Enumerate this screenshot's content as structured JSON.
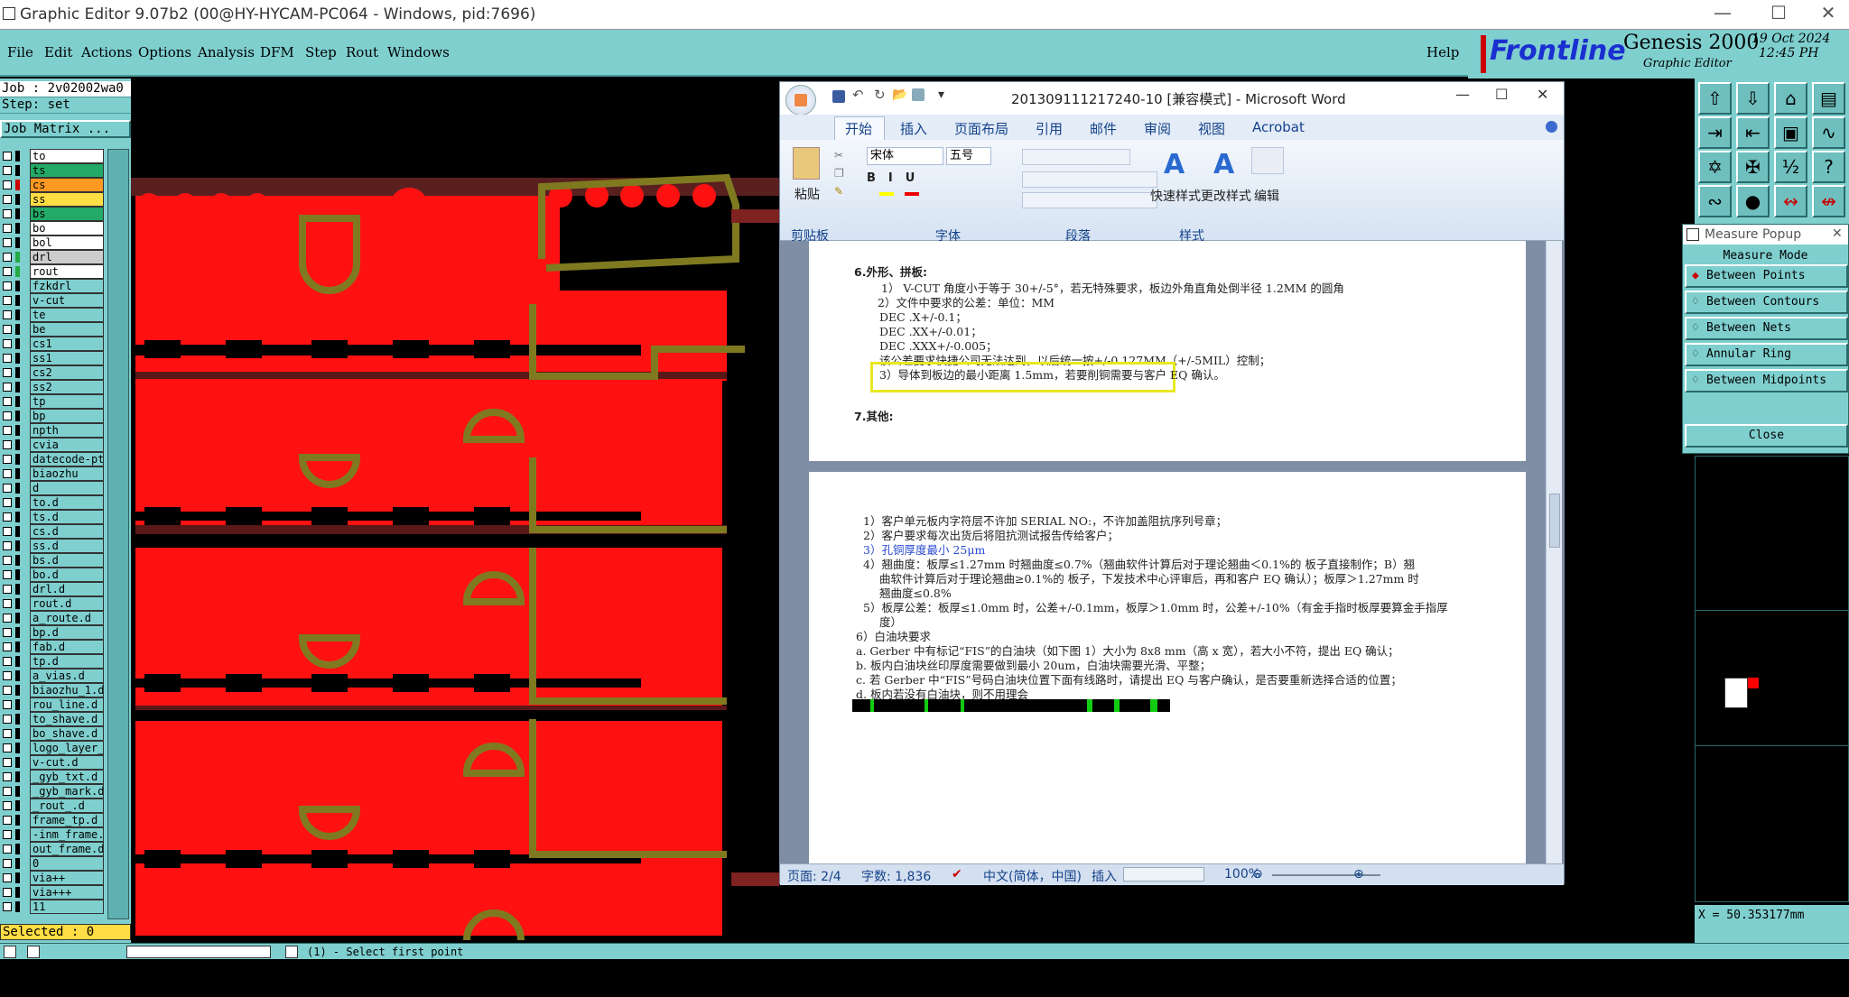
{
  "window": {
    "title": "Graphic Editor 9.07b2 (00@HY-HYCAM-PC064 - Windows, pid:7696)"
  },
  "menu": {
    "items": [
      "File",
      "Edit",
      "Actions",
      "Options",
      "Analysis",
      "DFM",
      "Step",
      "Rout",
      "Windows"
    ],
    "help": "Help"
  },
  "brand": {
    "logo": "Frontline",
    "product": "Genesis 2000",
    "subtitle": "Graphic Editor",
    "date": "19 Oct 2024",
    "time": "12:45 PH"
  },
  "left": {
    "job": "Job : 2v02002wa0",
    "step": "Step: set",
    "job_matrix": "Job Matrix ...",
    "selected": "Selected : 0",
    "layers": [
      {
        "name": "to",
        "color": "#ffffff",
        "sw": "#000000"
      },
      {
        "name": "ts",
        "color": "#22aa66",
        "sw": "#000000"
      },
      {
        "name": "cs",
        "color": "#ff9922",
        "sw": "#cc0000"
      },
      {
        "name": "ss",
        "color": "#ffdd44",
        "sw": "#000000"
      },
      {
        "name": "bs",
        "color": "#22aa66",
        "sw": "#000000"
      },
      {
        "name": "bo",
        "color": "#ffffff",
        "sw": "#000000"
      },
      {
        "name": "bol",
        "color": "#ffffff",
        "sw": "#000000"
      },
      {
        "name": "drl",
        "color": "#cccccc",
        "sw": "#22aa44"
      },
      {
        "name": "rout",
        "color": "#ffffff",
        "sw": "#22aa44"
      },
      {
        "name": "fzkdrl",
        "color": "#7fcfcf",
        "sw": "#000000"
      },
      {
        "name": "v-cut",
        "color": "#7fcfcf",
        "sw": "#000000"
      },
      {
        "name": "te",
        "color": "#7fcfcf",
        "sw": "#000000"
      },
      {
        "name": "be",
        "color": "#7fcfcf",
        "sw": "#000000"
      },
      {
        "name": "cs1",
        "color": "#7fcfcf",
        "sw": "#000000"
      },
      {
        "name": "ss1",
        "color": "#7fcfcf",
        "sw": "#000000"
      },
      {
        "name": "cs2",
        "color": "#7fcfcf",
        "sw": "#000000"
      },
      {
        "name": "ss2",
        "color": "#7fcfcf",
        "sw": "#000000"
      },
      {
        "name": "tp",
        "color": "#7fcfcf",
        "sw": "#000000"
      },
      {
        "name": "bp",
        "color": "#7fcfcf",
        "sw": "#000000"
      },
      {
        "name": "npth",
        "color": "#7fcfcf",
        "sw": "#000000"
      },
      {
        "name": "cvia",
        "color": "#7fcfcf",
        "sw": "#000000"
      },
      {
        "name": "datecode-pt",
        "color": "#7fcfcf",
        "sw": "#000000"
      },
      {
        "name": "biaozhu",
        "color": "#7fcfcf",
        "sw": "#000000"
      },
      {
        "name": "d",
        "color": "#7fcfcf",
        "sw": "#000000"
      },
      {
        "name": "to.d",
        "color": "#7fcfcf",
        "sw": "#000000"
      },
      {
        "name": "ts.d",
        "color": "#7fcfcf",
        "sw": "#000000"
      },
      {
        "name": "cs.d",
        "color": "#7fcfcf",
        "sw": "#000000"
      },
      {
        "name": "ss.d",
        "color": "#7fcfcf",
        "sw": "#000000"
      },
      {
        "name": "bs.d",
        "color": "#7fcfcf",
        "sw": "#000000"
      },
      {
        "name": "bo.d",
        "color": "#7fcfcf",
        "sw": "#000000"
      },
      {
        "name": "drl.d",
        "color": "#7fcfcf",
        "sw": "#000000"
      },
      {
        "name": "rout.d",
        "color": "#7fcfcf",
        "sw": "#000000"
      },
      {
        "name": "a_route.d",
        "color": "#7fcfcf",
        "sw": "#000000"
      },
      {
        "name": "bp.d",
        "color": "#7fcfcf",
        "sw": "#000000"
      },
      {
        "name": "fab.d",
        "color": "#7fcfcf",
        "sw": "#000000"
      },
      {
        "name": "tp.d",
        "color": "#7fcfcf",
        "sw": "#000000"
      },
      {
        "name": "a_vias.d",
        "color": "#7fcfcf",
        "sw": "#000000"
      },
      {
        "name": "biaozhu_1.d",
        "color": "#7fcfcf",
        "sw": "#000000"
      },
      {
        "name": "rou_line.d",
        "color": "#7fcfcf",
        "sw": "#000000"
      },
      {
        "name": "to_shave.d",
        "color": "#7fcfcf",
        "sw": "#000000"
      },
      {
        "name": "bo_shave.d",
        "color": "#7fcfcf",
        "sw": "#000000"
      },
      {
        "name": "logo_layer_",
        "color": "#7fcfcf",
        "sw": "#000000"
      },
      {
        "name": "v-cut.d",
        "color": "#7fcfcf",
        "sw": "#000000"
      },
      {
        "name": "_gyb_txt.d",
        "color": "#7fcfcf",
        "sw": "#000000"
      },
      {
        "name": "_gyb_mark.d",
        "color": "#7fcfcf",
        "sw": "#000000"
      },
      {
        "name": "_rout_.d",
        "color": "#7fcfcf",
        "sw": "#000000"
      },
      {
        "name": "frame_tp.d",
        "color": "#7fcfcf",
        "sw": "#000000"
      },
      {
        "name": "-inm_frame.",
        "color": "#7fcfcf",
        "sw": "#000000"
      },
      {
        "name": "out_frame.d",
        "color": "#7fcfcf",
        "sw": "#000000"
      },
      {
        "name": "0",
        "color": "#7fcfcf",
        "sw": "#000000"
      },
      {
        "name": "via++",
        "color": "#7fcfcf",
        "sw": "#000000"
      },
      {
        "name": "via+++",
        "color": "#7fcfcf",
        "sw": "#000000"
      },
      {
        "name": "11",
        "color": "#7fcfcf",
        "sw": "#000000"
      }
    ]
  },
  "word": {
    "title": "201309111217240-10 [兼容模式] - Microsoft Word",
    "tabs": [
      "开始",
      "插入",
      "页面布局",
      "引用",
      "邮件",
      "审阅",
      "视图",
      "Acrobat"
    ],
    "font_name": "宋体",
    "font_size": "五号",
    "paste": "粘贴",
    "quick_style": "快速样式",
    "change_style": "更改样式",
    "edit": "编辑",
    "groups": [
      "剪贴板",
      "字体",
      "段落",
      "样式"
    ],
    "page1": [
      "6.外形、拼板:",
      "1） V-CUT 角度小于等于 30+/-5°，若无特殊要求，板边外角直角处倒半径 1.2MM 的圆角",
      "2）文件中要求的公差：单位：MM",
      "DEC .X+/-0.1；",
      "DEC .XX+/-0.01；",
      "DEC .XXX+/-0.005；",
      "该公差要求快捷公司无法达到，以后统一按+/-0.127MM（+/-5MIL）控制；",
      "3）导体到板边的最小距离 1.5mm，若要削铜需要与客户 EQ 确认。",
      "7.其他:"
    ],
    "page2": [
      "1）客户单元板内字符层不许加 SERIAL NO:，不许加盖阻抗序列号章；",
      "2）客户要求每次出货后将阻抗测试报告传给客户；",
      "3）孔铜厚度最小 25μm",
      "4）翘曲度：板厚≤1.27mm 时翘曲度≤0.7%（翘曲软件计算后对于理论翘曲＜0.1%的 板子直接制作；B）翘",
      "曲软件计算后对于理论翘曲≥0.1%的 板子，下发技术中心评审后，再和客户 EQ 确认）；板厚＞1.27mm 时",
      "翘曲度≤0.8%",
      "5）板厚公差：板厚≤1.0mm 时，公差+/-0.1mm，板厚＞1.0mm 时，公差+/-10%（有金手指时板厚要算金手指厚",
      "度）",
      "6）白油块要求",
      "a. Gerber 中有标记“FIS”的白油块（如下图 1）大小为 8x8 mm（高 x 宽），若大小不符，提出 EQ 确认；",
      "b. 板内白油块丝印厚度需要做到最小 20um，白油块需要光滑、平整；",
      "c. 若 Gerber 中“FIS”号码白油块位置下面有线路时，请提出 EQ 与客户确认，是否要重新选择合适的位置；",
      "d. 板内若没有白油块，则不用理会"
    ],
    "status": {
      "page": "页面: 2/4",
      "words": "字数: 1,836",
      "lang": "中文(简体，中国)",
      "mode": "插入",
      "zoom": "100%"
    }
  },
  "measure": {
    "title": "Measure Popup",
    "mode": "Measure Mode",
    "options": [
      "Between Points",
      "Between Contours",
      "Between Nets",
      "Annular Ring",
      "Between Midpoints"
    ],
    "close": "Close"
  },
  "readout": {
    "x": "X = 50.353177mm"
  },
  "bottom": {
    "prompt": "(1) - Select first point"
  }
}
